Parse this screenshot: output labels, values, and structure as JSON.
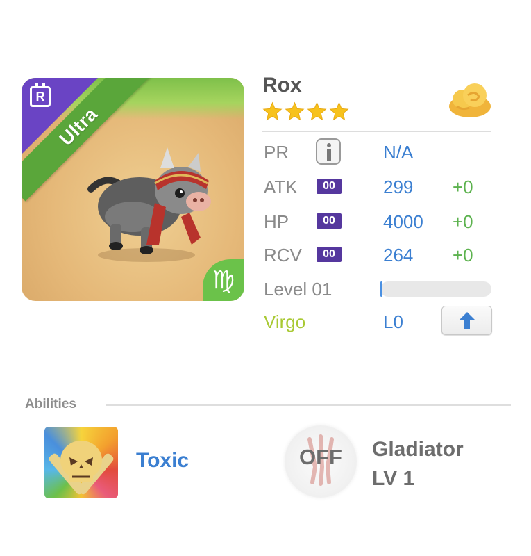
{
  "card": {
    "rarity_letter": "R",
    "tier_label": "Ultra",
    "zodiac_symbol": "♍",
    "art_icon": "boar-creature-art"
  },
  "pet": {
    "name": "Rox",
    "stars": 4,
    "currency_icon": "cloud-icon"
  },
  "stats": {
    "pr": {
      "label": "PR",
      "value": "N/A"
    },
    "atk": {
      "label": "ATK",
      "badge": "00",
      "value": "299",
      "bonus": "+0"
    },
    "hp": {
      "label": "HP",
      "badge": "00",
      "value": "4000",
      "bonus": "+0"
    },
    "rcv": {
      "label": "RCV",
      "badge": "00",
      "value": "264",
      "bonus": "+0"
    },
    "level": {
      "label": "Level 01",
      "progress": 0.02
    },
    "zodiac": {
      "label": "Virgo",
      "value": "L0"
    }
  },
  "abilities": {
    "title": "Abilities",
    "primary": {
      "name": "Toxic",
      "icon": "toxic-skull-icon"
    },
    "secondary": {
      "status": "OFF",
      "name": "Gladiator",
      "level": "LV 1",
      "icon": "claw-icon"
    }
  },
  "colors": {
    "accent_blue": "#3b7fd1",
    "bonus_green": "#5cb24e",
    "badge_purple": "#55379e",
    "zodiac_green": "#a9c934"
  }
}
